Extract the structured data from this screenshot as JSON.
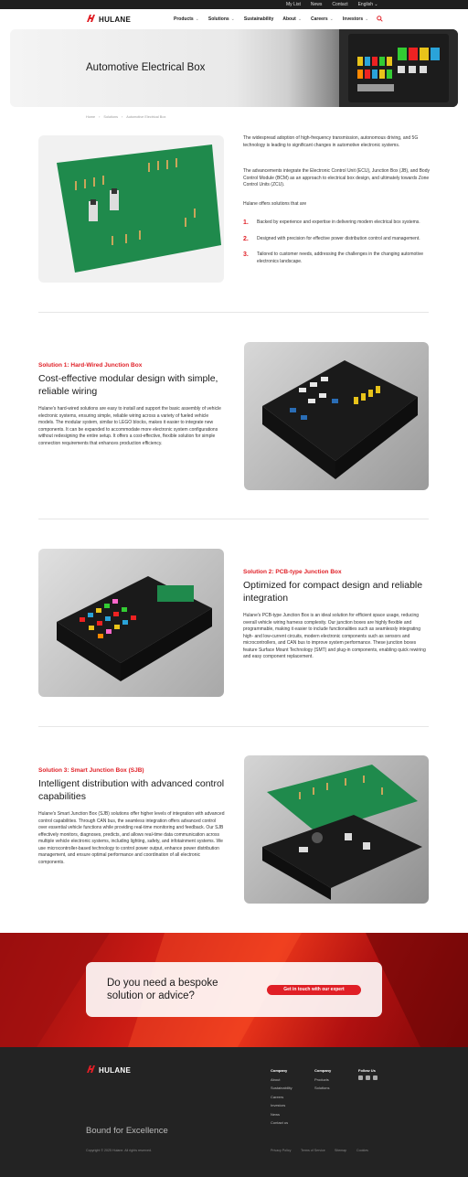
{
  "topbar": {
    "links": [
      "My List",
      "News",
      "Contact"
    ],
    "language": "English"
  },
  "nav": {
    "brand": "HULANE",
    "menu": [
      "Products",
      "Solutions",
      "Sustainability",
      "About",
      "Careers",
      "Investors"
    ]
  },
  "hero": {
    "title": "Automotive Electrical Box"
  },
  "breadcrumb": [
    "Home",
    "Solutions",
    "Automotive Electrical Box"
  ],
  "intro": {
    "p1": "The widespread adoption of high-frequency transmission, autonomous driving, and 5G technology is leading to significant changes in automotive electronic systems.",
    "p2": "The advancements integrate the Electronic Control Unit (ECU), Junction Box (JB), and Body Control Module (BCM) as an approach to electrical box design, and ultimately towards Zone Control Units (ZCU).",
    "p3": "Hulane offers solutions that are",
    "items": [
      {
        "num": "1.",
        "text": "Backed by experience and expertise in delivering modern electrical box systems."
      },
      {
        "num": "2.",
        "text": "Designed with precision for effective power distribution control and management."
      },
      {
        "num": "3.",
        "text": "Tailored to customer needs, addressing the challenges in the changing automotive electronics landscape."
      }
    ]
  },
  "solutions": [
    {
      "kicker": "Solution 1: Hard-Wired Junction Box",
      "title": "Cost-effective modular design with simple, reliable wiring",
      "body": "Hulane's hard-wired solutions are easy to install and support the basic assembly of vehicle electronic systems, ensuring simple, reliable wiring across a variety of fueled vehicle models. The modular system, similar to LEGO blocks, makes it easier to integrate new components. It can be expanded to accommodate more electronic system configurations without redesigning the entire setup. It offers a cost-effective, flexible solution for simple connection requirements that enhances production efficiency."
    },
    {
      "kicker": "Solution 2: PCB-type Junction Box",
      "title": "Optimized for compact design and reliable integration",
      "body": "Hulane's PCB-type Junction Box is an ideal solution for efficient space usage, reducing overall vehicle wiring harness complexity. Our junction boxes are highly flexible and programmable, making it easier to include functionalities such as seamlessly integrating high- and low-current circuits, modern electronic components such as sensors and microcontrollers, and CAN bus to improve system performance. These junction boxes feature Surface Mount Technology (SMT) and plug-in components, enabling quick rewiring and easy component replacement."
    },
    {
      "kicker": "Solution 3: Smart Junction Box (SJB)",
      "title": "Intelligent distribution with advanced control capabilities",
      "body": "Hulane's Smart Junction Box (SJB) solutions offer higher levels of integration with advanced control capabilities. Through CAN bus, the seamless integration offers advanced control over essential vehicle functions while providing real-time monitoring and feedback. Our SJB effectively monitors, diagnoses, predicts, and allows real-time data communication across multiple vehicle electronic systems, including lighting, safety, and infotainment systems. We use microcontroller-based technology to control power output, enhance power distribution management, and ensure optimal performance and coordination of all electronic components."
    }
  ],
  "cta": {
    "question": "Do you need a bespoke solution or advice?",
    "button": "Get in touch with our expert"
  },
  "footer": {
    "brand": "HULANE",
    "company_heading": "Company",
    "company_links": [
      "About",
      "Sustainability",
      "Careers",
      "Investors",
      "News",
      "Contact us"
    ],
    "company2_heading": "Company",
    "company2_links": [
      "Products",
      "Solutions"
    ],
    "follow_heading": "Follow Us",
    "tagline": "Bound for Excellence",
    "copyright": "Copyright © 2025 Hulane. All rights reserved.",
    "legal": [
      "Privacy Policy",
      "Terms of Service",
      "Sitemap",
      "Cookies"
    ]
  },
  "colors": {
    "accent": "#e01f26",
    "footer_bg": "#232323",
    "pcb_green": "#1f8a4c"
  }
}
